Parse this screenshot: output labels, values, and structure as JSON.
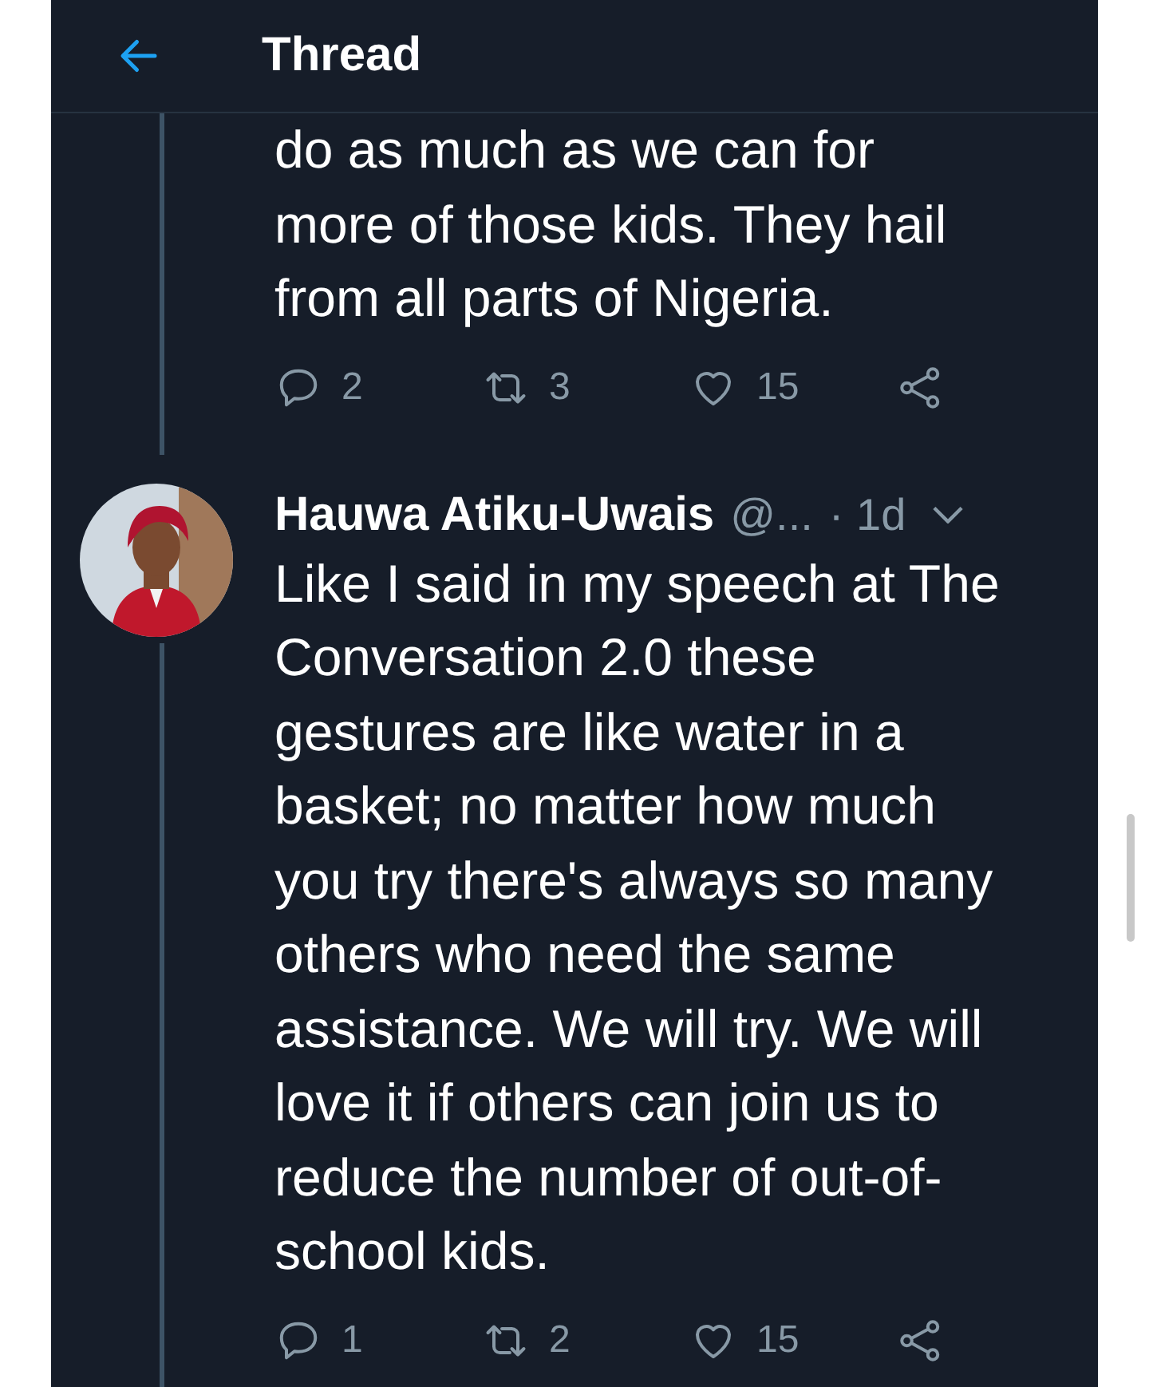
{
  "header": {
    "title": "Thread"
  },
  "tweets": [
    {
      "text": "do as much as we can for more of those kids. They hail from all parts of Nigeria.",
      "replies": "2",
      "retweets": "3",
      "likes": "15"
    },
    {
      "author": {
        "name": "Hauwa Atiku-Uwais",
        "handle": "@...",
        "time": "· 1d"
      },
      "text": "Like I said in my speech at The Conversation 2.0 these gestures are like water in a basket; no matter how much you try there's always so many others who need the same assistance. We will try. We will love it if others can join us to reduce the number of out-of-school kids.",
      "replies": "1",
      "retweets": "2",
      "likes": "15"
    }
  ]
}
